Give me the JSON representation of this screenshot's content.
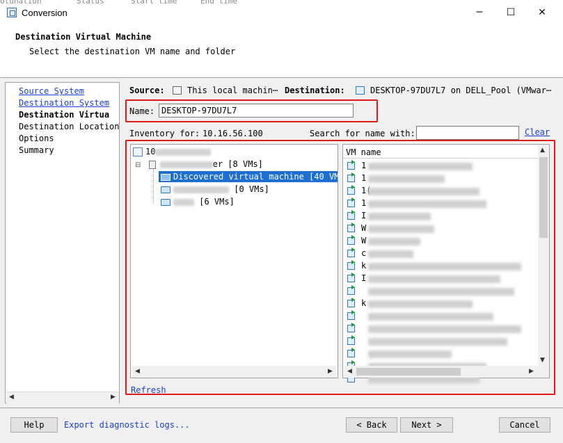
{
  "window": {
    "title": "Conversion",
    "ghost_text": [
      "otunation",
      "Status",
      "Start time",
      "End time"
    ]
  },
  "header": {
    "title": "Destination Virtual Machine",
    "subtitle": "Select the destination VM name and folder"
  },
  "nav": {
    "items": [
      {
        "label": "Source System",
        "style": "link"
      },
      {
        "label": "Destination System",
        "style": "link"
      },
      {
        "label": "Destination Virtua",
        "style": "current"
      },
      {
        "label": "Destination Location",
        "style": "plain"
      },
      {
        "label": "Options",
        "style": "plain"
      },
      {
        "label": "Summary",
        "style": "plain"
      }
    ]
  },
  "source": {
    "label": "Source:",
    "value": "This local machin⋯"
  },
  "destination": {
    "label": "Destination:",
    "value": "DESKTOP-97DU7L7 on DELL_Pool (VMwar⋯"
  },
  "name_field": {
    "label": "Name:",
    "value": "DESKTOP-97DU7L7"
  },
  "inventory": {
    "label": "Inventory for:",
    "host": "10.16.56.100"
  },
  "search": {
    "label": "Search for name with:",
    "value": "",
    "clear_label": "Clear"
  },
  "tree": {
    "root_prefix": "10",
    "datacenter_suffix": "er [8 VMs]",
    "expander": "⊟",
    "folders": [
      {
        "label": "Discovered virtual machine [40 VM",
        "selected": true
      },
      {
        "label": "[0 VMs]",
        "selected": false
      },
      {
        "label": "[6 VMs]",
        "selected": false
      }
    ]
  },
  "vm_list": {
    "column_header": "VM name",
    "visible_prefixes": [
      "1",
      "1",
      "1(",
      "1",
      "I",
      "W",
      "W",
      "c",
      "k",
      "I",
      "",
      "k",
      "",
      "",
      "",
      "",
      "",
      ""
    ]
  },
  "refresh_label": "Refresh",
  "footer": {
    "help": "Help",
    "export_link": "Export diagnostic logs...",
    "back": "< Back",
    "next": "Next >",
    "cancel": "Cancel"
  },
  "colors": {
    "highlight_border": "#e01818",
    "selection": "#1e6fd0",
    "link": "#1a3fd0"
  }
}
